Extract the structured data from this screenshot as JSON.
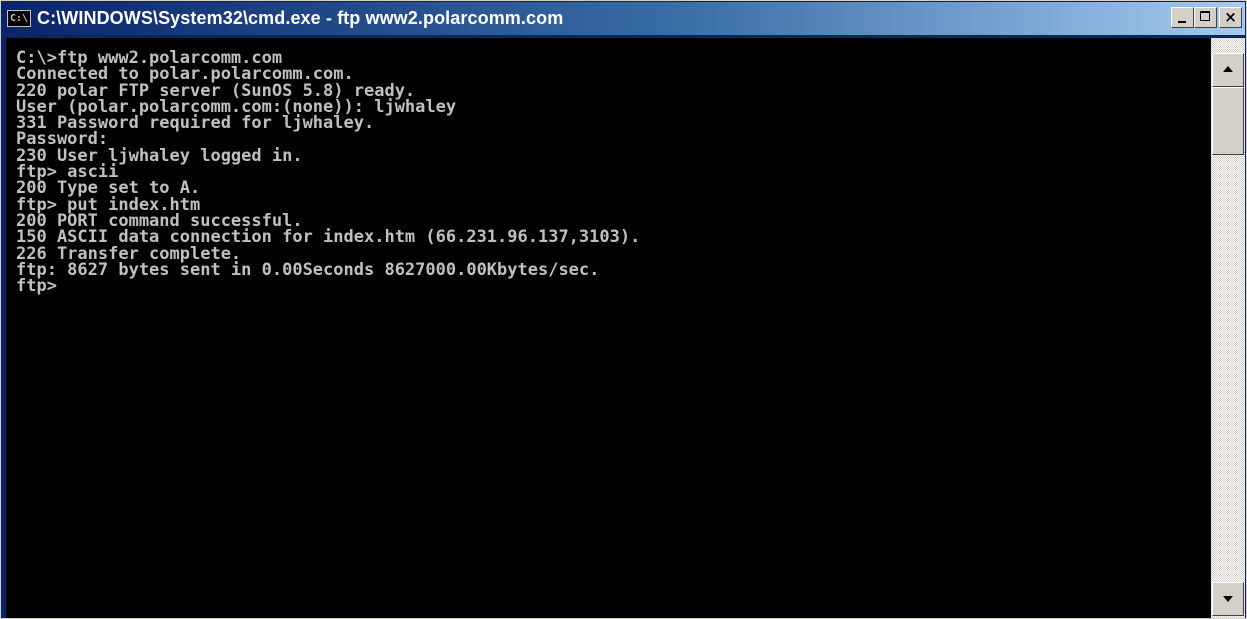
{
  "window": {
    "title": "C:\\WINDOWS\\System32\\cmd.exe - ftp www2.polarcomm.com",
    "icon_label": "C:\\",
    "icon": "console-app-icon",
    "buttons": {
      "minimize": "minimize-icon",
      "maximize": "maximize-icon",
      "close": "close-icon",
      "close_glyph": "×"
    }
  },
  "console": {
    "lines": [
      "C:\\>ftp www2.polarcomm.com",
      "Connected to polar.polarcomm.com.",
      "220 polar FTP server (SunOS 5.8) ready.",
      "User (polar.polarcomm.com:(none)): ljwhaley",
      "331 Password required for ljwhaley.",
      "Password:",
      "230 User ljwhaley logged in.",
      "ftp> ascii",
      "200 Type set to A.",
      "ftp> put index.htm",
      "200 PORT command successful.",
      "150 ASCII data connection for index.htm (66.231.96.137,3103).",
      "226 Transfer complete.",
      "ftp: 8627 bytes sent in 0.00Seconds 8627000.00Kbytes/sec.",
      "ftp>"
    ]
  },
  "colors": {
    "console_bg": "#000000",
    "console_fg": "#c0c0c0",
    "title_active": "#0a246a",
    "title_gradient_end": "#a6caf0",
    "chrome": "#d4d0c8"
  },
  "scrollbar": {
    "orientation": "vertical",
    "position": 0
  }
}
